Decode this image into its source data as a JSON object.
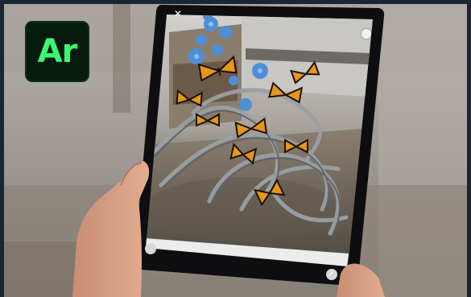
{
  "logo": {
    "text": "Ar",
    "background_color": "#061a0e",
    "text_color": "#3bf774"
  },
  "device": {
    "close_glyph": "✕",
    "confirm_glyph": "✓"
  },
  "colors": {
    "frame_border": "#1a2535",
    "tablet_bezel": "#0e0e10",
    "floor": "#6e6a62",
    "butterfly_orange": "#e8951c",
    "butterfly_black": "#1a1208",
    "flower_blue": "#4d8fd6",
    "metal_tube": "#9aa0a4"
  }
}
